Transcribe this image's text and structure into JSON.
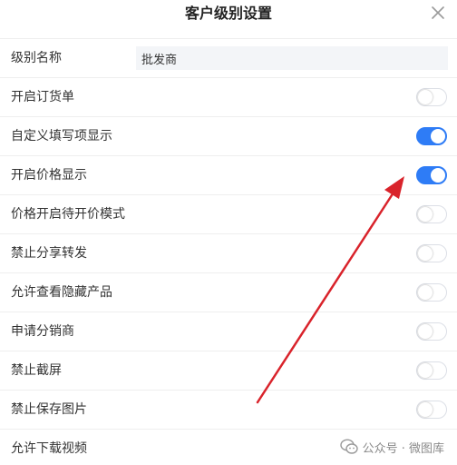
{
  "dialog": {
    "title": "客户级别设置",
    "close_icon": "close-icon"
  },
  "level_name": {
    "label": "级别名称",
    "value": "批发商"
  },
  "settings": [
    {
      "label": "开启订货单",
      "enabled": false
    },
    {
      "label": "自定义填写项显示",
      "enabled": true
    },
    {
      "label": "开启价格显示",
      "enabled": true
    },
    {
      "label": "价格开启待开价模式",
      "enabled": false
    },
    {
      "label": "禁止分享转发",
      "enabled": false
    },
    {
      "label": "允许查看隐藏产品",
      "enabled": false
    },
    {
      "label": "申请分销商",
      "enabled": false
    },
    {
      "label": "禁止截屏",
      "enabled": false
    },
    {
      "label": "禁止保存图片",
      "enabled": false
    },
    {
      "label": "允许下载视频",
      "enabled": false
    }
  ],
  "watermark": {
    "text": "公众号 · 微图库",
    "icon": "wechat-icon"
  },
  "colors": {
    "switch_on": "#2e7cf6",
    "arrow": "#d9232b"
  }
}
